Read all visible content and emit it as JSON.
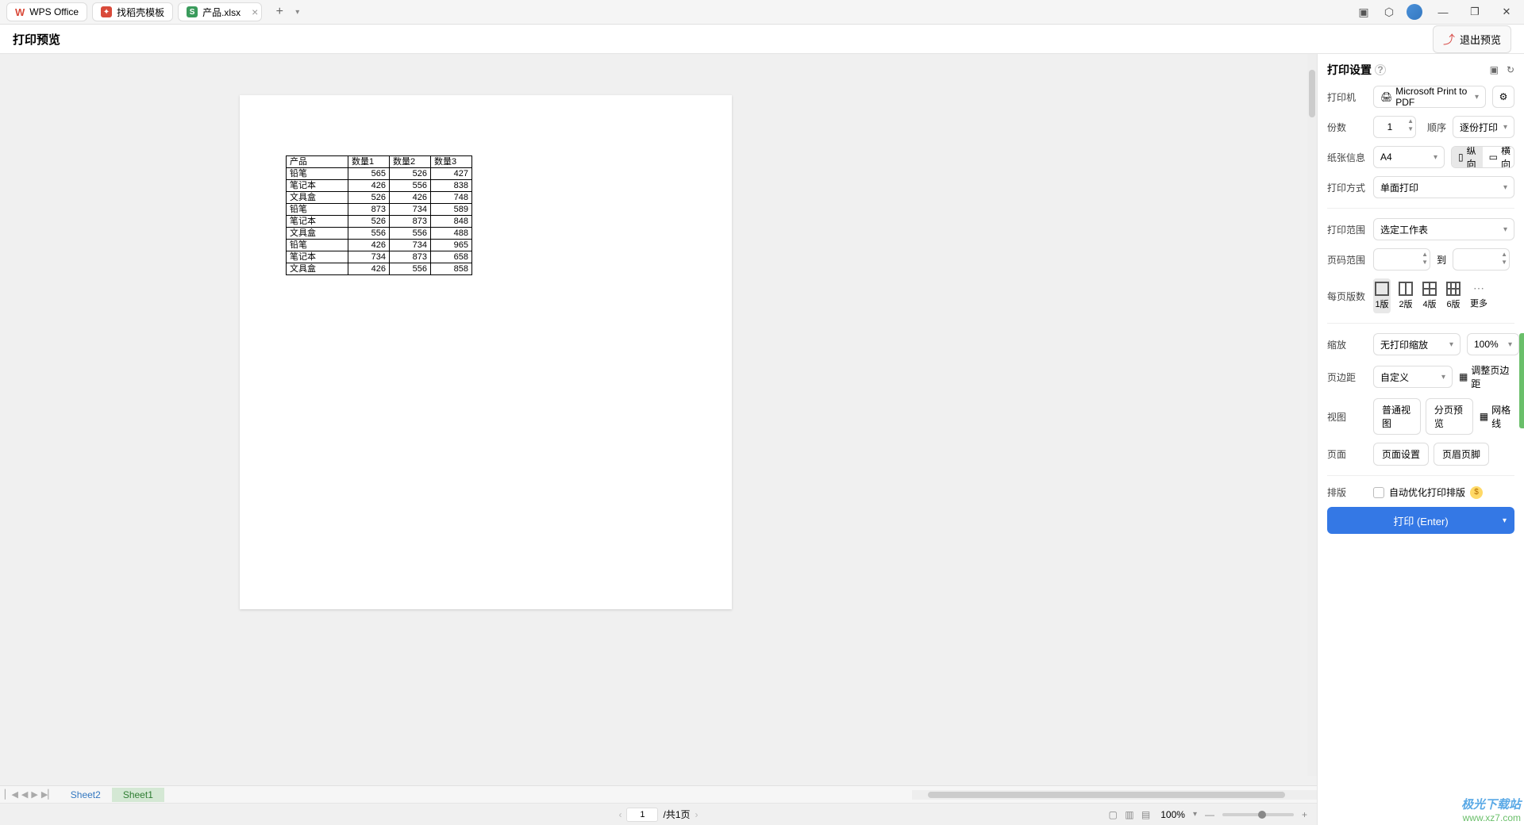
{
  "topBar": {
    "wpsTab": "WPS Office",
    "searchTab": "找稻壳模板",
    "docTab": "产品.xlsx"
  },
  "titleRow": {
    "title": "打印预览",
    "exitBtn": "退出预览"
  },
  "table": {
    "headers": [
      "产品",
      "数量1",
      "数量2",
      "数量3"
    ],
    "rows": [
      [
        "铅笔",
        565,
        526,
        427
      ],
      [
        "笔记本",
        426,
        556,
        838
      ],
      [
        "文具盒",
        526,
        426,
        748
      ],
      [
        "铅笔",
        873,
        734,
        589
      ],
      [
        "笔记本",
        526,
        873,
        848
      ],
      [
        "文具盒",
        556,
        556,
        488
      ],
      [
        "铅笔",
        426,
        734,
        965
      ],
      [
        "笔记本",
        734,
        873,
        658
      ],
      [
        "文具盒",
        426,
        556,
        858
      ]
    ]
  },
  "sheets": {
    "s1": "Sheet2",
    "s2": "Sheet1"
  },
  "statusBar": {
    "pageVal": "1",
    "pageTotal": "/共1页",
    "zoom": "100%"
  },
  "settings": {
    "title": "打印设置",
    "printerLabel": "打印机",
    "printerVal": "Microsoft Print to PDF",
    "copiesLabel": "份数",
    "copiesVal": "1",
    "orderLabel": "顺序",
    "orderVal": "逐份打印",
    "paperLabel": "纸张信息",
    "paperVal": "A4",
    "orient1": "纵向",
    "orient2": "横向",
    "duplexLabel": "打印方式",
    "duplexVal": "单面打印",
    "rangeLabel": "打印范围",
    "rangeVal": "选定工作表",
    "pageRangeLabel": "页码范围",
    "toLabel": "到",
    "perPageLabel": "每页版数",
    "opt1": "1版",
    "opt2": "2版",
    "opt4": "4版",
    "opt6": "6版",
    "optMore": "更多",
    "scaleLabel": "缩放",
    "scaleVal": "无打印缩放",
    "scalePct": "100%",
    "marginLabel": "页边距",
    "marginVal": "自定义",
    "marginAdjust": "调整页边距",
    "viewLabel": "视图",
    "viewNormal": "普通视图",
    "viewPage": "分页预览",
    "viewGrid": "网格线",
    "pageSetupLabel": "页面",
    "pageSetup": "页面设置",
    "headerFooter": "页眉页脚",
    "layoutLabel": "排版",
    "autoOpt": "自动优化打印排版",
    "printBtnLabel": "打印 (Enter)"
  },
  "watermark": {
    "l1": "极光下载站",
    "l2": "www.xz7.com"
  }
}
